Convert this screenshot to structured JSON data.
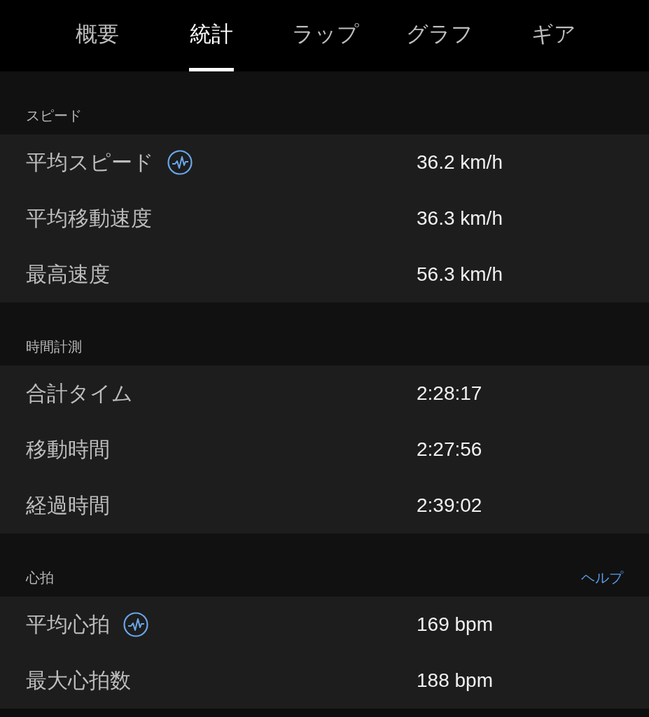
{
  "tabs": [
    {
      "label": "概要",
      "selected": false
    },
    {
      "label": "統計",
      "selected": true
    },
    {
      "label": "ラップ",
      "selected": false
    },
    {
      "label": "グラフ",
      "selected": false
    },
    {
      "label": "ギア",
      "selected": false
    }
  ],
  "sections": [
    {
      "title": "スピード",
      "rows": [
        {
          "label": "平均スピード",
          "chart_icon": true,
          "value": "36.2 km/h"
        },
        {
          "label": "平均移動速度",
          "chart_icon": false,
          "value": "36.3 km/h"
        },
        {
          "label": "最高速度",
          "chart_icon": false,
          "value": "56.3 km/h"
        }
      ]
    },
    {
      "title": "時間計測",
      "rows": [
        {
          "label": "合計タイム",
          "chart_icon": false,
          "value": "2:28:17"
        },
        {
          "label": "移動時間",
          "chart_icon": false,
          "value": "2:27:56"
        },
        {
          "label": "経過時間",
          "chart_icon": false,
          "value": "2:39:02"
        }
      ]
    },
    {
      "title": "心拍",
      "link": "ヘルプ",
      "rows": [
        {
          "label": "平均心拍",
          "chart_icon": true,
          "value": "169 bpm"
        },
        {
          "label": "最大心拍数",
          "chart_icon": false,
          "value": "188 bpm"
        }
      ]
    }
  ]
}
